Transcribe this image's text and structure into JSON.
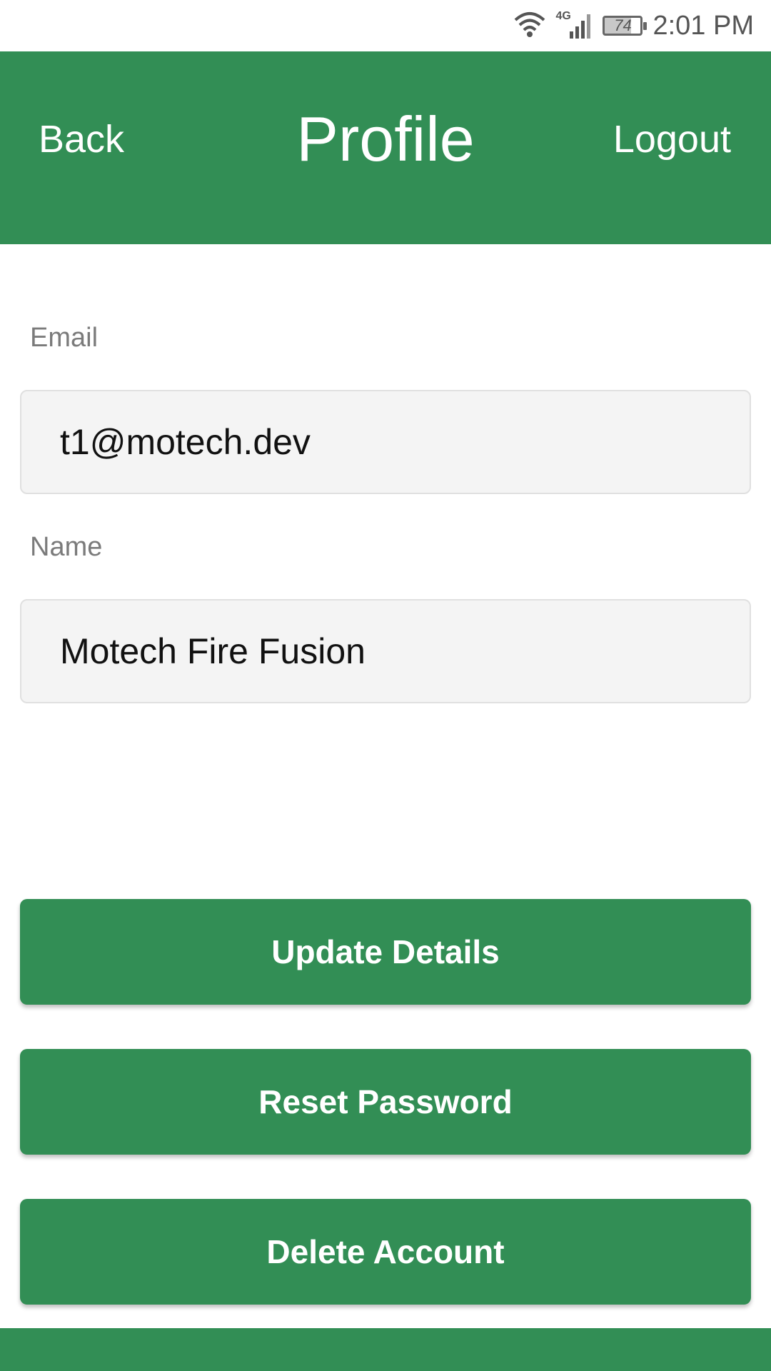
{
  "status_bar": {
    "time": "2:01 PM",
    "battery_level": "74",
    "network_type": "4G",
    "icons": [
      "wifi-icon",
      "signal-icon",
      "battery-icon"
    ]
  },
  "header": {
    "back_label": "Back",
    "title": "Profile",
    "logout_label": "Logout"
  },
  "form": {
    "email": {
      "label": "Email",
      "value": "t1@motech.dev"
    },
    "name": {
      "label": "Name",
      "value": "Motech Fire Fusion"
    }
  },
  "actions": {
    "update_label": "Update Details",
    "reset_label": "Reset Password",
    "delete_label": "Delete Account"
  },
  "colors": {
    "primary": "#328e55",
    "input_background": "#f4f4f4",
    "label_text": "#7b7b7b"
  }
}
